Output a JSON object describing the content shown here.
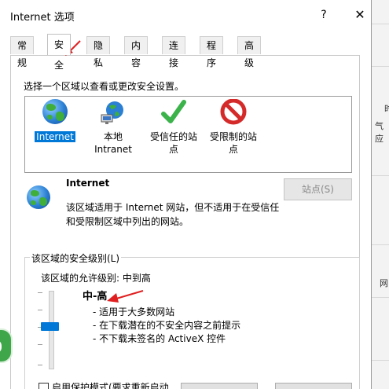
{
  "dialog": {
    "title": "Internet 选项",
    "help_glyph": "?",
    "close_glyph": "✕"
  },
  "tabs": [
    {
      "label": "常规",
      "active": false
    },
    {
      "label": "安全",
      "active": true
    },
    {
      "label": "隐私",
      "active": false
    },
    {
      "label": "内容",
      "active": false
    },
    {
      "label": "连接",
      "active": false
    },
    {
      "label": "程序",
      "active": false
    },
    {
      "label": "高级",
      "active": false
    }
  ],
  "security": {
    "instruction": "选择一个区域以查看或更改安全设置。",
    "zones": [
      {
        "label": "Internet",
        "icon": "globe-icon",
        "selected": true
      },
      {
        "label": "本地\nIntranet",
        "icon": "intranet-icon",
        "selected": false
      },
      {
        "label": "受信任的站\n点",
        "icon": "checkmark-icon",
        "selected": false
      },
      {
        "label": "受限制的站\n点",
        "icon": "no-entry-icon",
        "selected": false
      }
    ],
    "zone_info": {
      "title": "Internet",
      "description": "该区域适用于 Internet 网站，但不适用于在受信任和受限制区域中列出的网站。",
      "sites_button": "站点(S)"
    },
    "level_group": {
      "legend": "该区域的安全级别(L)",
      "allowed_levels": "该区域的允许级别: 中到高",
      "current_level": "中-高",
      "level_details": [
        "- 适用于大多数网站",
        "- 在下载潜在的不安全内容之前提示",
        "- 不下载未签名的 ActiveX 控件"
      ],
      "protected_mode_label": "启用保护模式(要求重新启动"
    }
  },
  "background": {
    "fragments": [
      "时",
      "气应",
      "网"
    ]
  },
  "colors": {
    "accent": "#0078d7",
    "annotation_arrow": "#e02020"
  }
}
